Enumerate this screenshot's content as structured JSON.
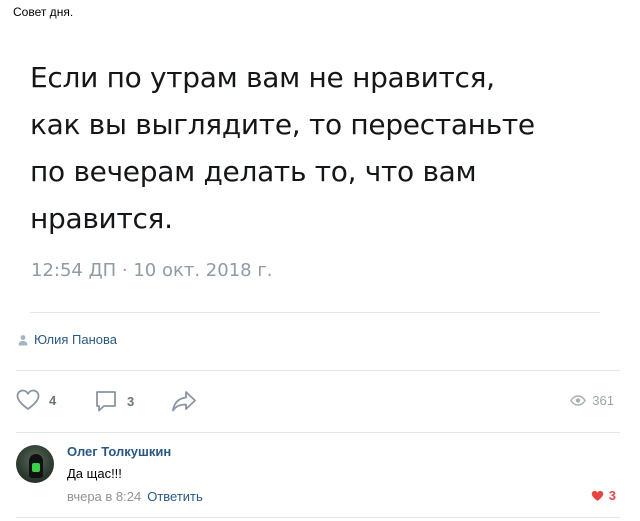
{
  "caption": "Совет дня.",
  "tweet": {
    "lines": [
      "Если по утрам вам не нравится,",
      "как вы выглядите, то перестаньте",
      "по вечерам делать то, что вам",
      "нравится."
    ],
    "timestamp": "12:54 ДП · 10 окт. 2018 г."
  },
  "author": {
    "name": "Юлия Панова",
    "icon": "user-icon"
  },
  "actions": {
    "likes": "4",
    "comments": "3",
    "views": "361",
    "icons": [
      "heart-icon",
      "comment-icon",
      "share-icon",
      "eye-icon"
    ]
  },
  "comment": {
    "author": "Олег Толкушкин",
    "text": "Да щас!!!",
    "time": "вчера в 8:24",
    "reply_label": "Ответить",
    "likes": "3"
  },
  "colors": {
    "link": "#2a5885",
    "muted": "#939393",
    "like_active": "#e64646",
    "timestamp": "#8f9ba6"
  }
}
